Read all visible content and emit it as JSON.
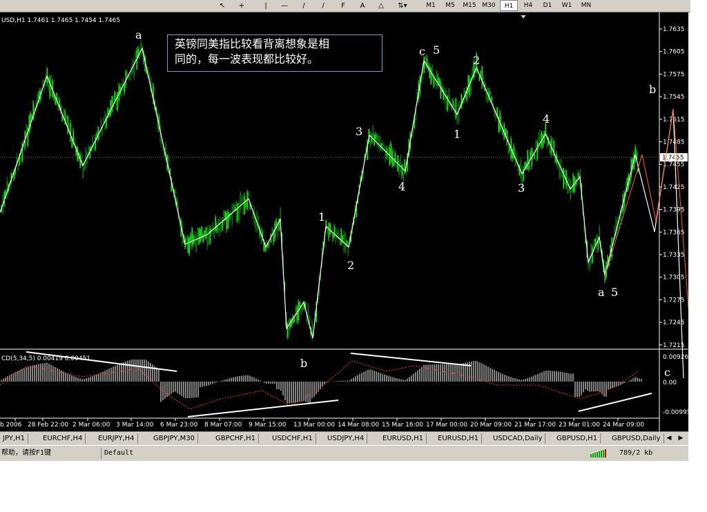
{
  "toolbar": {
    "timeframes": [
      "M1",
      "M5",
      "M15",
      "M30",
      "H1",
      "H4",
      "D1",
      "W1",
      "MN"
    ],
    "active_timeframe": "H1"
  },
  "chart": {
    "header": "USD,H1  1.7461 1.7465 1.7454 1.7465",
    "current_price": "1.7455",
    "price_ticks": [
      "1.7635",
      "1.7605",
      "1.7575",
      "1.7545",
      "1.7515",
      "1.7485",
      "1.7455",
      "1.7425",
      "1.7395",
      "1.7365",
      "1.7335",
      "1.7305",
      "1.7275",
      "1.7245",
      "1.7215"
    ],
    "macd_header": "CD(5,34,5) 0.00419 0.00451",
    "macd_ticks": [
      "0.00926",
      "0.00",
      "-0.00995"
    ],
    "date_ticks": [
      "b 2006",
      "28 Feb 22:00",
      "2 Mar 06:00",
      "3 Mar 14:00",
      "6 Mar 23:00",
      "8 Mar 07:00",
      "9 Mar 15:00",
      "13 Mar 00:00",
      "14 Mar 08:00",
      "15 Mar 16:00",
      "17 Mar 00:00",
      "20 Mar 09:00",
      "21 Mar 17:00",
      "23 Mar 01:00",
      "24 Mar 09:00"
    ],
    "wave_labels": [
      "a",
      "1",
      "2",
      "3",
      "4",
      "c",
      "5",
      "2",
      "1",
      "4",
      "3",
      "b",
      "a",
      "5"
    ],
    "macd_labels": [
      "b",
      "c"
    ],
    "annotation_line1": "英镑同美指比较看背离想象是相",
    "annotation_line2": "同的，每一波表现都比较好。",
    "colors": {
      "bull": "#00ff00",
      "bear": "#008000",
      "wave": "#ffffff",
      "proj": "#ff6030",
      "macd": "#a0a0a0",
      "signal": "#ff3030"
    }
  },
  "tabs": [
    "JPY,H1",
    "EURCHF,H4",
    "EURJPY,H4",
    "GBPJPY,M30",
    "GBPCHF,H1",
    "USDCHF,H1",
    "USDJPY,H4",
    "EURUSD,H1",
    "EURUSD,H1",
    "USDCAD,Daily",
    "GBPUSD,H1",
    "GBPUSD,Daily"
  ],
  "status": {
    "help": "帮助，请按F1键",
    "profile": "Default",
    "traffic": "789/2 kb"
  }
}
